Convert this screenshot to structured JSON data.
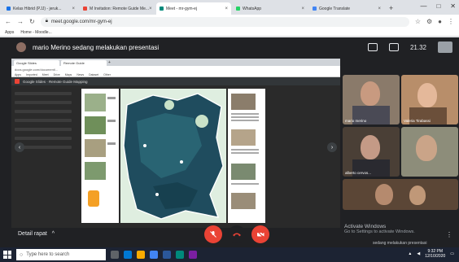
{
  "browser": {
    "tabs": [
      {
        "label": "Kelas Hibrid (PJJ) - jeruk...",
        "color": "#1a73e8"
      },
      {
        "label": "M Invitation: Remote Guide Me...",
        "color": "#ea4335"
      },
      {
        "label": "Meet - mr-gym-ej",
        "color": "#00897b",
        "active": true
      },
      {
        "label": "WhatsApp",
        "color": "#25d366"
      },
      {
        "label": "Google Translate",
        "color": "#4285f4"
      }
    ],
    "url": "meet.google.com/mr-gym-ej",
    "bookmarks": [
      "Apps",
      "Home - Moodle..."
    ],
    "window_controls": [
      "—",
      "□",
      "✕"
    ]
  },
  "meet": {
    "presenter_text": "mario Merino sedang melakukan presentasi",
    "time": "21.32",
    "detail_label": "Detail rapat",
    "detail_chevron": "^",
    "activate_title": "Activate Windows",
    "activate_sub": "Go to Settings to activate Windows.",
    "presenting_label": "sedang melakukan presentasi",
    "kebab": "⋮"
  },
  "shared_screen": {
    "inner_tabs": [
      "Google Slides",
      "Remote Guide",
      "+"
    ],
    "inner_url": "docs.google.com/document/...",
    "inner_bookmarks": [
      "Apps",
      "Imported",
      "Meet",
      "Drive",
      "Maps",
      "News",
      "Dataset",
      "Other"
    ],
    "doc_title": "Google Slides · Remote Guide Mapping",
    "nav_left": "‹",
    "nav_right": "›"
  },
  "participants": [
    {
      "name": "mario merino",
      "color": "#6d4c41"
    },
    {
      "name": "Valeria Tirabassi",
      "color": "#5d4037"
    },
    {
      "name": "alberto cervos...",
      "color": "#4e342e"
    },
    {
      "name": "",
      "color": "#8d8d7a"
    },
    {
      "name": "",
      "color": "#5b4636"
    }
  ],
  "taskbar": {
    "search_placeholder": "Type here to search",
    "clock_time": "9:32 PM",
    "clock_date": "12/10/2020"
  },
  "colors": {
    "end_call": "#ea4335",
    "meet_bg": "#202124"
  }
}
